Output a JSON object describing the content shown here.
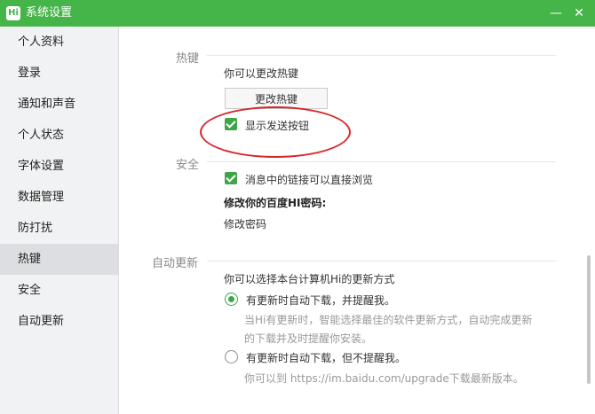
{
  "window": {
    "title": "系统设置",
    "logo_text": "Hi",
    "minimize_label": "—",
    "close_label": "✕"
  },
  "sidebar": {
    "items": [
      {
        "label": "个人资料",
        "active": false
      },
      {
        "label": "登录",
        "active": false
      },
      {
        "label": "通知和声音",
        "active": false
      },
      {
        "label": "个人状态",
        "active": false
      },
      {
        "label": "字体设置",
        "active": false
      },
      {
        "label": "数据管理",
        "active": false
      },
      {
        "label": "防打扰",
        "active": false
      },
      {
        "label": "热键",
        "active": true
      },
      {
        "label": "安全",
        "active": false
      },
      {
        "label": "自动更新",
        "active": false
      }
    ]
  },
  "hotkey": {
    "section_label": "热键",
    "desc": "你可以更改热键",
    "change_button": "更改热键",
    "show_send_button": {
      "label": "显示发送按钮",
      "checked": true
    }
  },
  "security": {
    "section_label": "安全",
    "link_browse": {
      "label": "消息中的链接可以直接浏览",
      "checked": true
    },
    "password_heading": "修改你的百度HI密码:",
    "change_password": "修改密码"
  },
  "auto_update": {
    "section_label": "自动更新",
    "desc": "你可以选择本台计算机Hi的更新方式",
    "option1": {
      "label": "有更新时自动下载，并提醒我。",
      "selected": true,
      "hint_line1": "当Hi有更新时，智能选择最佳的软件更新方式，自动完成更新",
      "hint_line2": "的下载并及时提醒你安装。"
    },
    "option2": {
      "label": "有更新时自动下载，但不提醒我。",
      "selected": false,
      "hint": "你可以到 https://im.baidu.com/upgrade下载最新版本。"
    }
  },
  "colors": {
    "titlebar": "#45b549",
    "accent": "#3fa648",
    "annotation": "#d7262b"
  }
}
